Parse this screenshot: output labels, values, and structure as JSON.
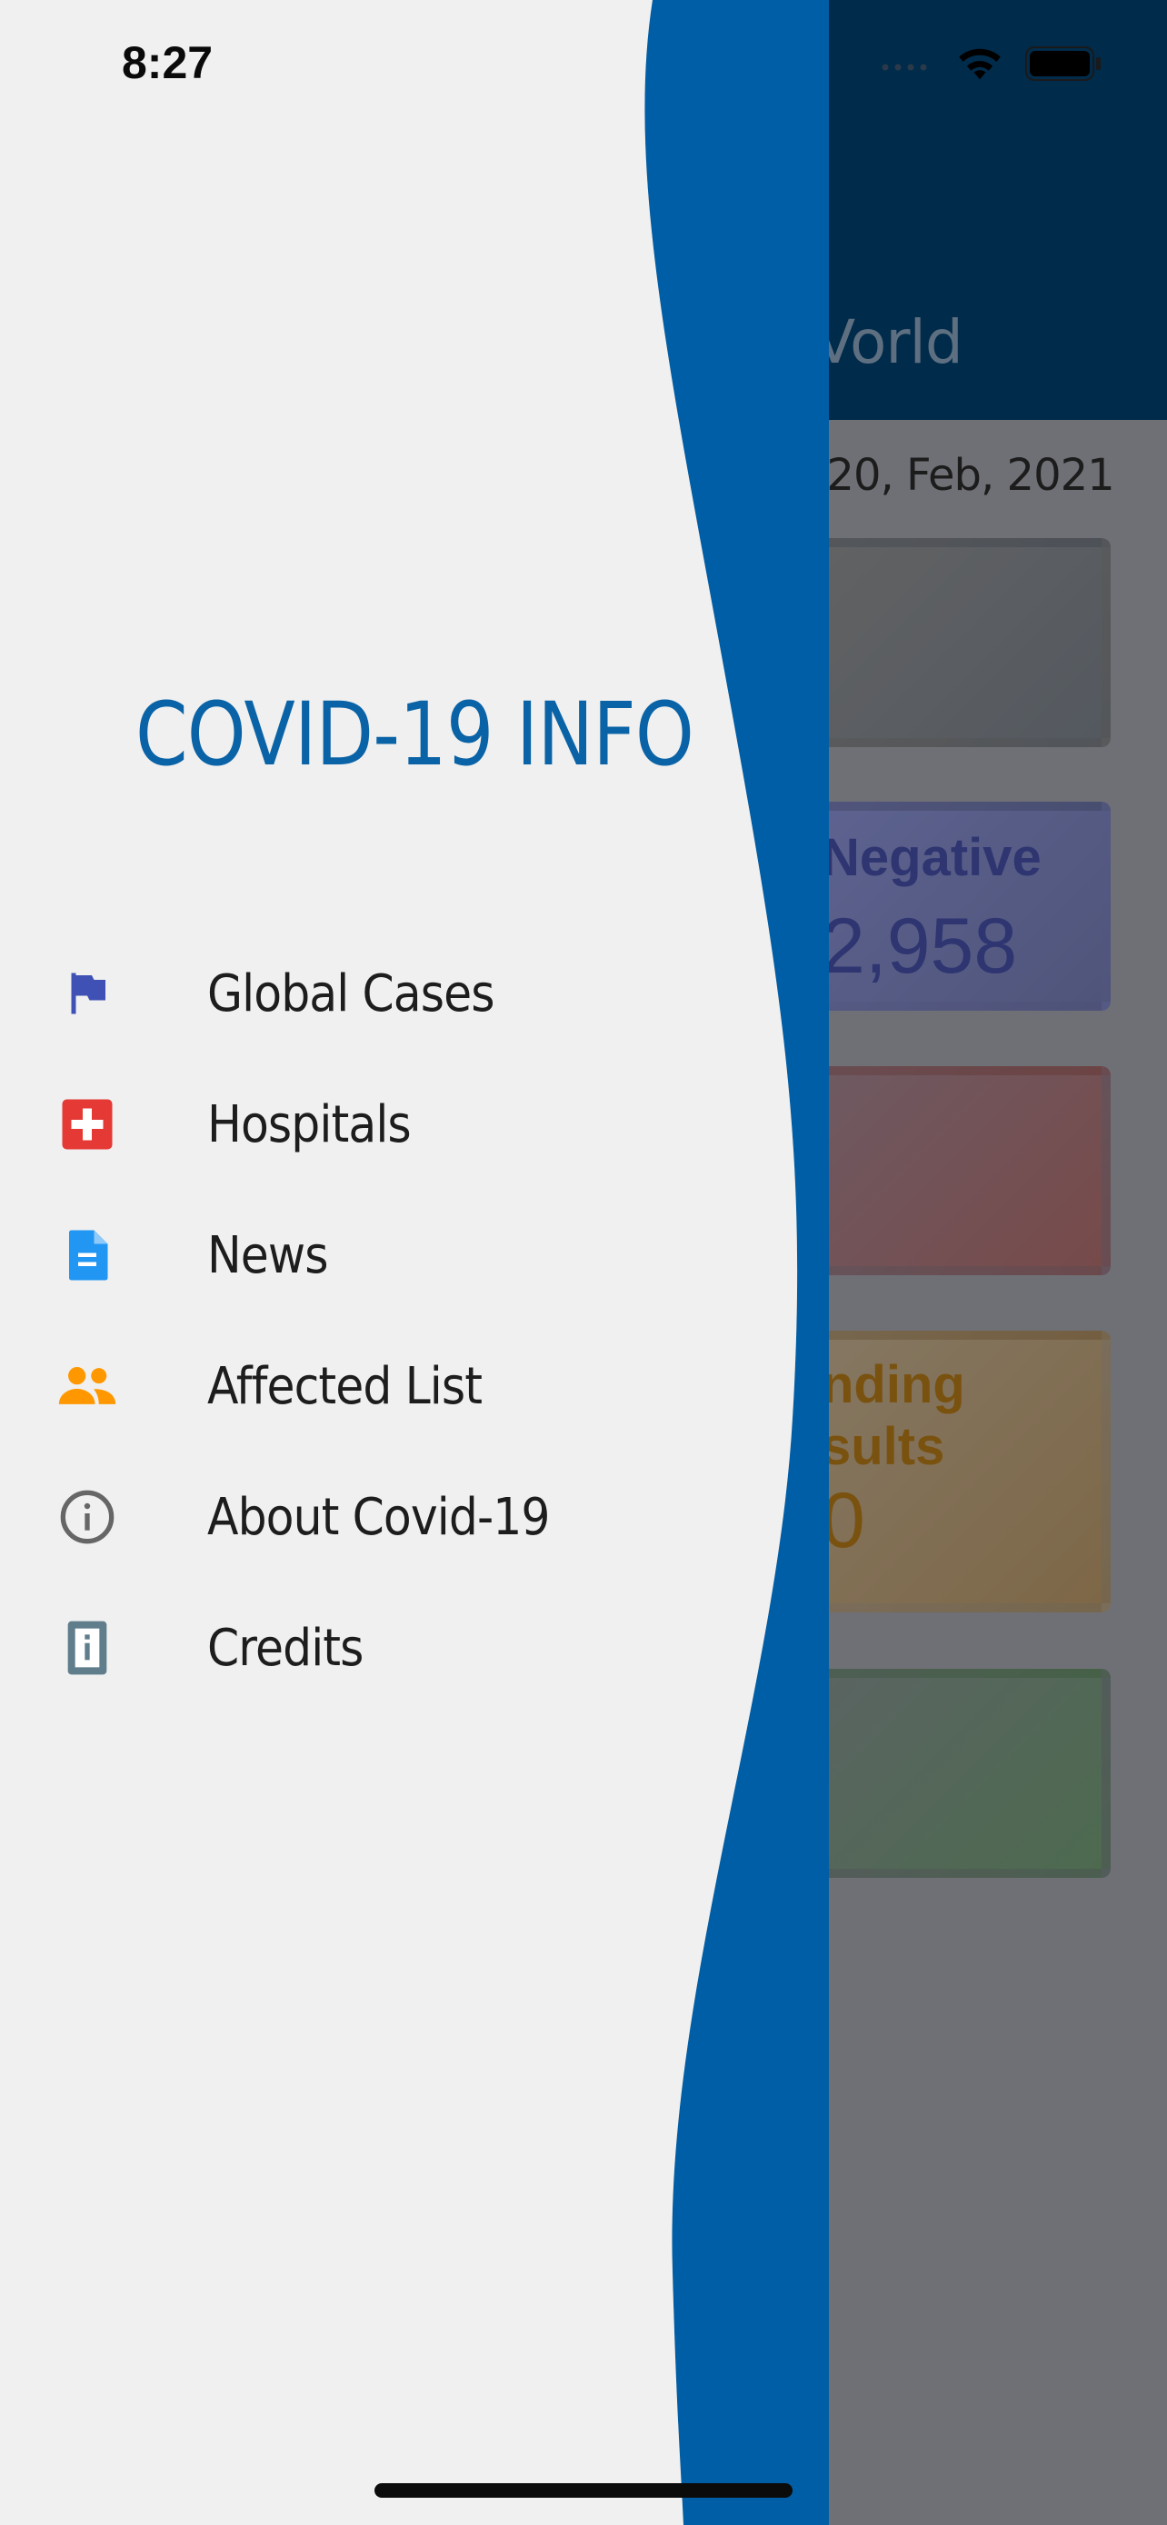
{
  "status_bar": {
    "time": "8:27"
  },
  "background_screen": {
    "title_partial": "Vorld",
    "date_partial": ": 20, Feb, 2021",
    "cards": {
      "negative_label": "Negative",
      "negative_value": "2,958",
      "pending_label_line1": "nding",
      "pending_label_line2": "sults",
      "pending_value": "0"
    }
  },
  "drawer": {
    "title": "COVID-19 INFO",
    "items": [
      {
        "label": "Global Cases",
        "icon": "flag-icon",
        "color": "#3f51b5"
      },
      {
        "label": "Hospitals",
        "icon": "hospital-icon",
        "color": "#e53935"
      },
      {
        "label": "News",
        "icon": "document-icon",
        "color": "#2196f3"
      },
      {
        "label": "Affected List",
        "icon": "people-icon",
        "color": "#ff9800"
      },
      {
        "label": "About Covid-19",
        "icon": "info-icon",
        "color": "#666666"
      },
      {
        "label": "Credits",
        "icon": "credits-icon",
        "color": "#607d8b"
      }
    ]
  },
  "colors": {
    "drawer_background": "#f0f0f0",
    "wave_blue": "#005ea6",
    "header_navy": "#002b4a",
    "title_blue": "#0a63a6"
  }
}
